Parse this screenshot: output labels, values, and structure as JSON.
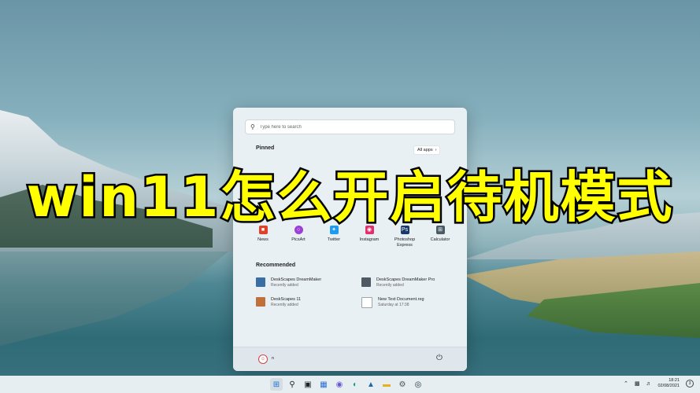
{
  "banner": {
    "title": "win11怎么开启待机模式"
  },
  "search": {
    "placeholder": "Type here to search"
  },
  "pinned": {
    "title": "Pinned",
    "all_apps_label": "All apps",
    "apps": [
      {
        "label": "News",
        "color": "#e0402a"
      },
      {
        "label": "PicsArt",
        "color": "#9b3fd6"
      },
      {
        "label": "Twitter",
        "color": "#1d9bf0"
      },
      {
        "label": "Instagram",
        "color": "#e1306c"
      },
      {
        "label": "Photoshop\nExpress",
        "color": "#1b3a6b"
      },
      {
        "label": "Calculator",
        "color": "#4a5a66"
      }
    ]
  },
  "recommended": {
    "title": "Recommended",
    "items": [
      {
        "name": "DeskScapes DreamMaker",
        "sub": "Recently added",
        "color": "#3a6ea5"
      },
      {
        "name": "DeskScapes DreamMaker Pro",
        "sub": "Recently added",
        "color": "#4d5a63"
      },
      {
        "name": "DeskScapes 11",
        "sub": "Recently added",
        "color": "#c0703a"
      },
      {
        "name": "New Text Document.reg",
        "sub": "Saturday at 17:38",
        "color": "#9aa6ad"
      }
    ]
  },
  "user": {
    "name": "n"
  },
  "clock": {
    "time": "18:21",
    "date": "02/08/2021"
  },
  "tray": {
    "notification_count": "3"
  }
}
